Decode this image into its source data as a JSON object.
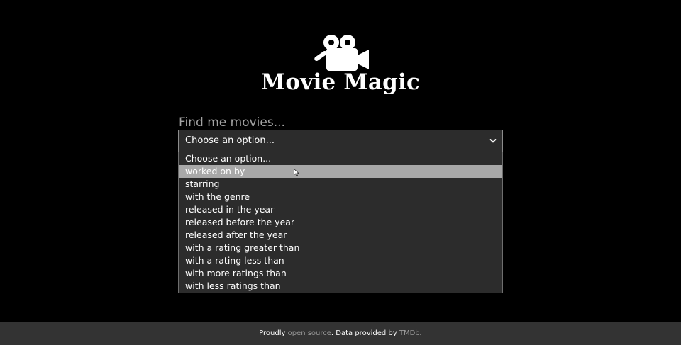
{
  "app": {
    "title": "Movie Magic",
    "logo_icon": "movie-camera-icon"
  },
  "search": {
    "prompt": "Find me movies...",
    "selected_value": "Choose an option...",
    "options": [
      "Choose an option...",
      "worked on by",
      "starring",
      "with the genre",
      "released in the year",
      "released before the year",
      "released after the year",
      "with a rating greater than",
      "with a rating less than",
      "with more ratings than",
      "with less ratings than"
    ],
    "highlighted_option": "worked on by"
  },
  "footer": {
    "prefix": "Proudly ",
    "open_source_link": "open source",
    "middle": ". Data provided by ",
    "tmdb_link": "TMDb",
    "suffix": "."
  },
  "colors": {
    "background": "#000000",
    "footer_background": "#333333",
    "select_background": "#2c2c2c",
    "highlight": "#a8a8a8",
    "prompt_text": "#a3a3a3",
    "link_text": "#9a9a9a"
  }
}
